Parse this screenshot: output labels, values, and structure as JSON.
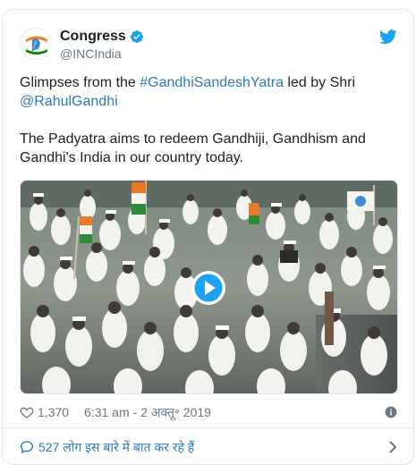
{
  "account": {
    "display_name": "Congress",
    "handle": "@INCIndia"
  },
  "tweet": {
    "intro": "Glimpses from the ",
    "hashtag": "#GandhiSandeshYatra",
    "middle": " led by Shri",
    "mention": "@RahulGandhi",
    "line3": "The Padyatra aims to redeem Gandhiji, Gandhism and",
    "line4": "Gandhi's India in our country today."
  },
  "meta": {
    "likes": "1,370",
    "timestamp": "6:31 am - 2 अक्तू॰ 2019"
  },
  "footer": {
    "conversation": "527 लोग इस बारे में बात कर रहे हैं"
  },
  "colors": {
    "link": "#2b7bb9",
    "secondary_text": "#697882",
    "twitter_blue": "#1da1f2",
    "verified": "#1da1f2",
    "play_button": "#1da1f2"
  },
  "icons": {
    "verified": "verified-badge-icon",
    "logo": "twitter-bird-icon",
    "like": "heart-icon",
    "info": "info-icon",
    "reply": "speech-bubble-icon",
    "more": "chevron-right-icon",
    "play": "play-icon"
  }
}
